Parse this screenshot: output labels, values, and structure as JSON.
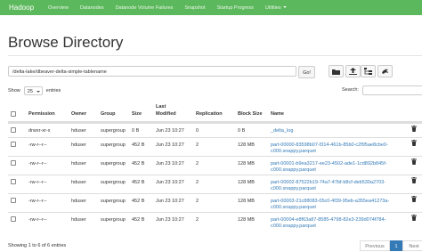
{
  "navbar": {
    "brand": "Hadoop",
    "items": [
      "Overview",
      "Datanodes",
      "Datanode Volume Failures",
      "Snapshot",
      "Startup Progress",
      "Utilities"
    ]
  },
  "page_title": "Browse Directory",
  "path": {
    "value": "/delta-lake/dbeaver-delta-simple-tablename",
    "go_label": "Go!"
  },
  "toolbar_icons": [
    "folder-icon",
    "upload-icon",
    "folder-tree-icon",
    "dolphin-icon"
  ],
  "show": {
    "prefix": "Show",
    "value": "25",
    "suffix": "entries"
  },
  "search": {
    "label": "Search:",
    "value": ""
  },
  "columns": [
    "Permission",
    "Owner",
    "Group",
    "Size",
    "Last Modified",
    "Replication",
    "Block Size",
    "Name"
  ],
  "rows": [
    {
      "permission": "drwxr-xr-x",
      "owner": "hduser",
      "group": "supergroup",
      "size": "0 B",
      "modified": "Jun 23 10:27",
      "replication": "0",
      "block": "0 B",
      "name": [
        "_delta_log"
      ]
    },
    {
      "permission": "-rw-r--r--",
      "owner": "hduser",
      "group": "supergroup",
      "size": "452 B",
      "modified": "Jun 23 10:27",
      "replication": "2",
      "block": "128 MB",
      "name": [
        "part-00000-83598b07-f314-461b-85b0-c2f95ae8cbe0-",
        "c000.snappy.parquet"
      ]
    },
    {
      "permission": "-rw-r--r--",
      "owner": "hduser",
      "group": "supergroup",
      "size": "452 B",
      "modified": "Jun 23 10:27",
      "replication": "2",
      "block": "128 MB",
      "name": [
        "part-00001-b9ea3217-ee23-4502-ade1-1cd892b845f-",
        "c000.snappy.parquet"
      ]
    },
    {
      "permission": "-rw-r--r--",
      "owner": "hduser",
      "group": "supergroup",
      "size": "452 B",
      "modified": "Jun 23 10:27",
      "replication": "2",
      "block": "128 MB",
      "name": [
        "part-00002-87522b19-74a7-47bf-b8cf-deb530a2703-",
        "c000.snappy.parquet"
      ]
    },
    {
      "permission": "-rw-r--r--",
      "owner": "hduser",
      "group": "supergroup",
      "size": "452 B",
      "modified": "Jun 23 10:27",
      "replication": "2",
      "block": "128 MB",
      "name": [
        "part-00003-21c88083-05c0-4f39-95eb-a355ea41273a-",
        "c000.snappy.parquet"
      ]
    },
    {
      "permission": "-rw-r--r--",
      "owner": "hduser",
      "group": "supergroup",
      "size": "452 B",
      "modified": "Jun 23 10:27",
      "replication": "2",
      "block": "128 MB",
      "name": [
        "part-00004-e8f63a87-8585-4798-82e3-239d074f784-",
        "c000.snappy.parquet"
      ]
    }
  ],
  "footer": {
    "info": "Showing 1 to 6 of 6 entries",
    "previous": "Previous",
    "page": "1",
    "next": "Next"
  },
  "colors": {
    "navbar": "#5cb85c",
    "link": "#337ab7"
  }
}
